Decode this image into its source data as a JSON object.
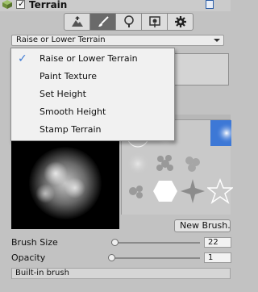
{
  "header": {
    "title": "Terrain",
    "enabled_check": "✓",
    "icon": "terrain-cube-icon"
  },
  "toolbar": {
    "tools": [
      {
        "name": "raise-terrain-tool",
        "icon": "mountain-up-icon"
      },
      {
        "name": "paint-tool",
        "icon": "brush-icon",
        "active": true
      },
      {
        "name": "tree-tool",
        "icon": "tree-icon"
      },
      {
        "name": "detail-tool",
        "icon": "flower-icon"
      },
      {
        "name": "settings-tool",
        "icon": "gear-icon"
      }
    ]
  },
  "mode_dropdown": {
    "value": "Raise or Lower Terrain"
  },
  "menu": {
    "items": [
      {
        "label": "Raise or Lower Terrain",
        "checked": true
      },
      {
        "label": "Paint Texture"
      },
      {
        "label": "Set Height"
      },
      {
        "label": "Smooth Height"
      },
      {
        "label": "Stamp Terrain"
      }
    ],
    "check_glyph": "✓"
  },
  "brushes": {
    "new_brush_label": "New Brush...",
    "selected_index": 2
  },
  "settings": {
    "brush_size": {
      "label": "Brush Size",
      "value": "22",
      "fraction": 0.05
    },
    "opacity": {
      "label": "Opacity",
      "value": "1",
      "fraction": 0.0
    }
  },
  "footer": {
    "builtin_label": "Built-in brush"
  },
  "colors": {
    "selection_blue": "#3d78d6",
    "check_blue": "#3f7bd4",
    "panel_bg": "#c2c2c2"
  }
}
